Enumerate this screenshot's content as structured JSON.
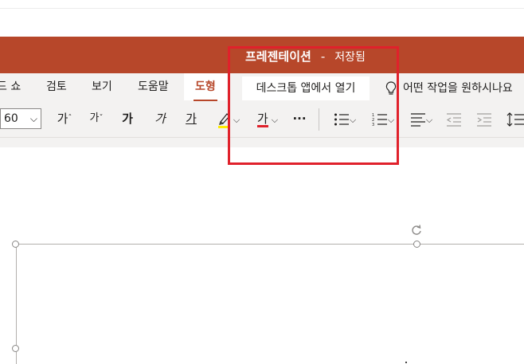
{
  "title": {
    "name": "프레젠테이션",
    "separator": "-",
    "status": "저장됨"
  },
  "tabs": [
    {
      "label": "드 쇼"
    },
    {
      "label": "검토"
    },
    {
      "label": "보기"
    },
    {
      "label": "도움말"
    },
    {
      "label": "도형"
    }
  ],
  "open_desktop_label": "데스크톱 앱에서 열기",
  "tell_me_label": "어떤 작업을 원하시나요",
  "toolbar": {
    "font_size": "60",
    "grow_font": "가",
    "shrink_font": "가",
    "bold": "가",
    "italic": "가",
    "underline": "가",
    "font_color": "가",
    "more": "···"
  },
  "colors": {
    "brand": "#b7472a",
    "highlight_yellow": "#ffeb00",
    "font_red": "#e0212b",
    "annotation_red": "#e0212b"
  }
}
